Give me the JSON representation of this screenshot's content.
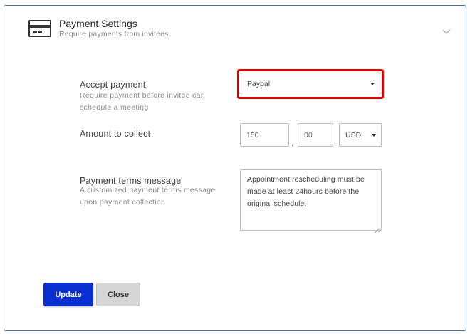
{
  "header": {
    "title": "Payment Settings",
    "subtitle": "Require payments from invitees",
    "icon": "credit-card-icon"
  },
  "accept_payment": {
    "label": "Accept payment",
    "help": "Require payment before invitee can schedule a meeting",
    "selected": "Paypal"
  },
  "amount": {
    "label": "Amount to collect",
    "whole": "150",
    "separator": ".",
    "cents": "00",
    "currency": "USD"
  },
  "terms": {
    "label": "Payment terms message",
    "help": "A customized payment terms message upon payment collection",
    "message": "Appointment rescheduling must be made at least 24hours before the original schedule."
  },
  "buttons": {
    "update": "Update",
    "close": "Close"
  },
  "colors": {
    "primary": "#0a2fd0",
    "highlight": "#e00000",
    "border": "#4a6fb5"
  }
}
